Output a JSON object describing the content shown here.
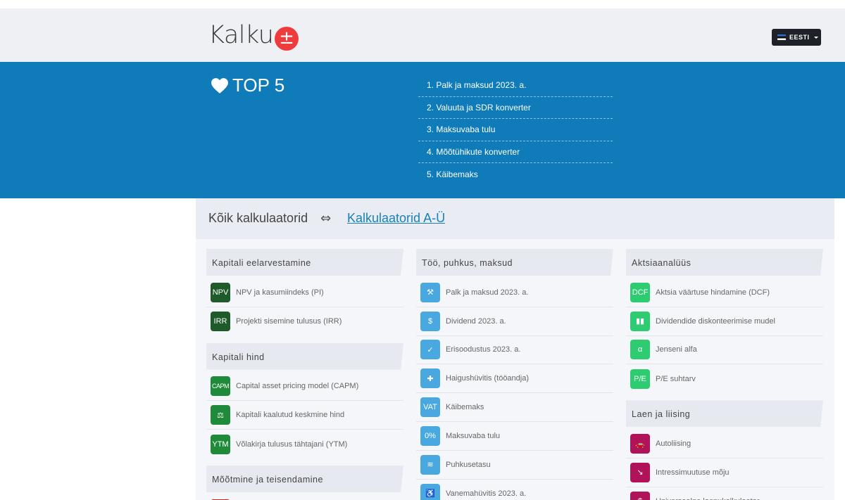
{
  "header": {
    "logo_text": "Kalku",
    "logo_badge": "±",
    "language_label": "EESTI"
  },
  "top5": {
    "title": "TOP 5",
    "items": [
      "1. Palk ja maksud 2023. a.",
      "2. Valuuta ja SDR konverter",
      "3. Maksuvaba tulu",
      "4. Mõõtühikute konverter",
      "5. Käibemaks"
    ]
  },
  "tabs": {
    "all": "Kõik kalkulaatorid",
    "arrow": "⇔",
    "az": "Kalkulaatorid A-Ü"
  },
  "colors": {
    "hero": "#0f7bb8",
    "dark_green": "#1e5e2c",
    "green": "#2e8b3c",
    "light_blue": "#4aa8e0",
    "bright_green": "#2ecc71",
    "crimson": "#b0135a"
  },
  "columns": [
    {
      "groups": [
        {
          "title": "Kapitali eelarvestamine",
          "items": [
            {
              "icon": "NPV",
              "color": "#1f5a2a",
              "label": "NPV ja kasumiindeks (PI)"
            },
            {
              "icon": "IRR",
              "color": "#1f5a2a",
              "label": "Projekti sisemine tulusus (IRR)"
            }
          ]
        },
        {
          "title": "Kapitali hind",
          "items": [
            {
              "icon": "CAPM",
              "color": "#1f8a3a",
              "label": "Capital asset pricing model (CAPM)"
            },
            {
              "icon": "⚖",
              "color": "#1f8a3a",
              "label": "Kapitali kaalutud keskmine hind"
            },
            {
              "icon": "YTM",
              "color": "#1f8a3a",
              "label": "Võlakirja tulusus tähtajani (YTM)"
            }
          ]
        },
        {
          "title": "Mõõtmine ja teisendamine",
          "items": [
            {
              "icon": "",
              "color": "#c0281e",
              "label": ""
            }
          ]
        }
      ]
    },
    {
      "groups": [
        {
          "title": "Töö, puhkus, maksud",
          "items": [
            {
              "icon": "⚒",
              "color": "#4aa8e0",
              "label": "Palk ja maksud 2023. a."
            },
            {
              "icon": "$",
              "color": "#4aa8e0",
              "label": "Dividend 2023. a."
            },
            {
              "icon": "✓",
              "color": "#4aa8e0",
              "label": "Erisoodustus 2023. a."
            },
            {
              "icon": "✚",
              "color": "#4aa8e0",
              "label": "Haigushüvitis (tööandja)"
            },
            {
              "icon": "VAT",
              "color": "#4aa8e0",
              "label": "Käibemaks"
            },
            {
              "icon": "0%",
              "color": "#4aa8e0",
              "label": "Maksuvaba tulu"
            },
            {
              "icon": "≋",
              "color": "#4aa8e0",
              "label": "Puhkusetasu"
            },
            {
              "icon": "♿",
              "color": "#4aa8e0",
              "label": "Vanemahüvitis 2023. a."
            }
          ]
        }
      ]
    },
    {
      "groups": [
        {
          "title": "Aktsiaanalüüs",
          "items": [
            {
              "icon": "DCF",
              "color": "#2ecc71",
              "label": "Aktsia väärtuse hindamine (DCF)"
            },
            {
              "icon": "▮▮",
              "color": "#2ecc71",
              "label": "Dividendide diskonteerimise mudel"
            },
            {
              "icon": "α",
              "color": "#2ecc71",
              "label": "Jenseni alfa"
            },
            {
              "icon": "P/E",
              "color": "#2ecc71",
              "label": "P/E suhtarv"
            }
          ]
        },
        {
          "title": "Laen ja liising",
          "items": [
            {
              "icon": "🚗",
              "color": "#b0135a",
              "label": "Autoliising"
            },
            {
              "icon": "↘",
              "color": "#b0135a",
              "label": "Intressimuutuse mõju"
            },
            {
              "icon": "$",
              "color": "#b0135a",
              "label": "Universaalne laenukalkulaator"
            }
          ]
        }
      ]
    }
  ]
}
